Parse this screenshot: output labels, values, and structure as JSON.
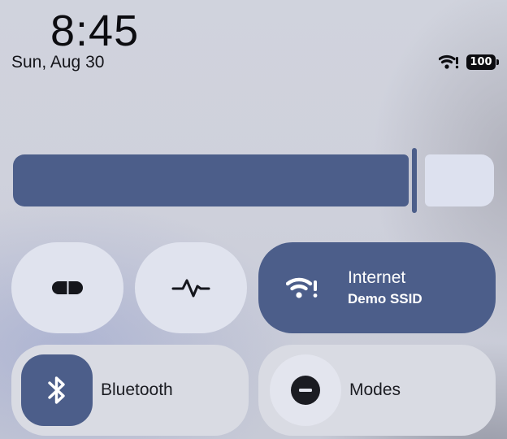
{
  "status_bar": {
    "time": "8:45",
    "date": "Sun, Aug 30",
    "wifi_icon": "wifi-alert-icon",
    "battery_level": "100"
  },
  "brightness": {
    "level": 0.83,
    "accent_color": "#4c5e8a",
    "track_color": "#dde1ef"
  },
  "tiles": {
    "flashlight": {
      "icon": "flashlight-icon"
    },
    "activity": {
      "icon": "pulse-icon"
    },
    "internet": {
      "label": "Internet",
      "sublabel": "Demo SSID",
      "icon": "wifi-alert-icon",
      "active": true
    },
    "bluetooth": {
      "label": "Bluetooth",
      "icon": "bluetooth-icon",
      "active": true
    },
    "modes": {
      "label": "Modes",
      "icon": "do-not-disturb-icon",
      "active": false
    }
  },
  "colors": {
    "active_tile": "#4c5e8a",
    "inactive_tile": "#d9dbe3",
    "round_tile": "#e0e3ee"
  }
}
